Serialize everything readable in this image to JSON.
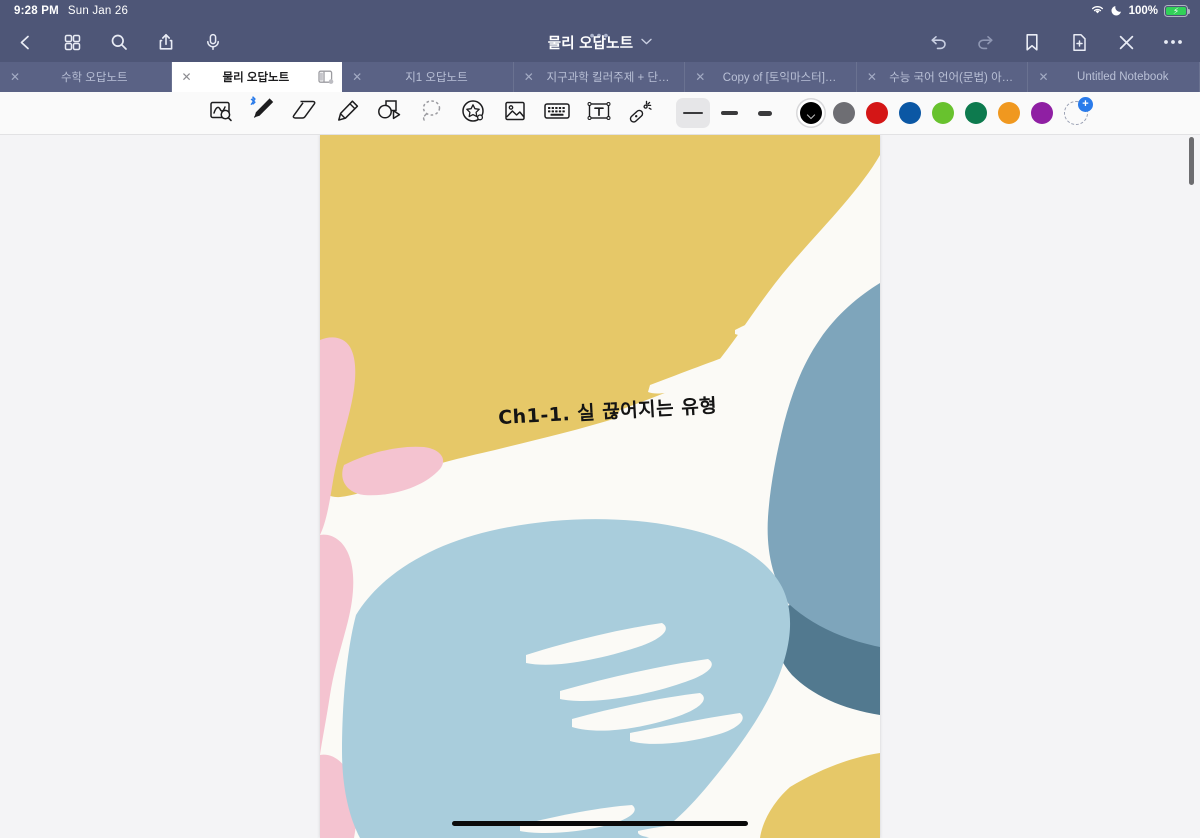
{
  "statusbar": {
    "time": "9:28 PM",
    "date": "Sun Jan 26",
    "battery_percent": "100%",
    "icons": [
      "wifi-icon",
      "moon-icon",
      "battery-charging-icon"
    ]
  },
  "titlebar": {
    "title": "물리 오답노트",
    "chevron": "⌄",
    "left_buttons": [
      {
        "name": "back-button",
        "icon": "chevron-left-icon"
      },
      {
        "name": "thumbnail-grid-button",
        "icon": "grid-icon"
      },
      {
        "name": "search-button",
        "icon": "search-icon"
      },
      {
        "name": "share-button",
        "icon": "share-icon"
      },
      {
        "name": "microphone-button",
        "icon": "microphone-icon"
      }
    ],
    "right_buttons": [
      {
        "name": "undo-button",
        "icon": "undo-icon"
      },
      {
        "name": "redo-button",
        "icon": "redo-icon"
      },
      {
        "name": "bookmark-button",
        "icon": "bookmark-icon"
      },
      {
        "name": "add-page-button",
        "icon": "document-plus-icon"
      },
      {
        "name": "close-button",
        "icon": "close-x-icon"
      },
      {
        "name": "more-button",
        "icon": "ellipsis-icon"
      }
    ]
  },
  "tabs": [
    {
      "label": "수학 오답노트",
      "active": false,
      "close": "✕"
    },
    {
      "label": "물리 오답노트",
      "active": true,
      "close": "✕"
    },
    {
      "label": "지1 오답노트",
      "active": false,
      "close": "✕"
    },
    {
      "label": "지구과학 킬러주제 + 단…",
      "active": false,
      "close": "✕"
    },
    {
      "label": "Copy of [토익마스터]…",
      "active": false,
      "close": "✕"
    },
    {
      "label": "수능 국어 언어(문법) 아…",
      "active": false,
      "close": "✕"
    },
    {
      "label": "Untitled Notebook",
      "active": false,
      "close": "✕"
    }
  ],
  "toolbar": {
    "tools": [
      {
        "name": "zoom-write-tool",
        "icon": "zoom-write-icon",
        "selected": false
      },
      {
        "name": "pen-tool",
        "icon": "pen-icon",
        "selected": true,
        "bluetooth": true
      },
      {
        "name": "eraser-tool",
        "icon": "eraser-icon",
        "selected": false
      },
      {
        "name": "highlighter-tool",
        "icon": "highlighter-icon",
        "selected": false
      },
      {
        "name": "shapes-tool",
        "icon": "shapes-icon",
        "selected": false
      },
      {
        "name": "lasso-tool",
        "icon": "lasso-icon",
        "selected": false
      },
      {
        "name": "sticker-tool",
        "icon": "sticker-star-icon",
        "selected": false
      },
      {
        "name": "image-tool",
        "icon": "image-icon",
        "selected": false
      },
      {
        "name": "keyboard-tool",
        "icon": "keyboard-icon",
        "selected": false
      },
      {
        "name": "text-box-tool",
        "icon": "text-box-icon",
        "selected": false
      },
      {
        "name": "magic-wand-tool",
        "icon": "magic-wand-icon",
        "selected": false
      }
    ],
    "stroke_widths": [
      {
        "name": "stroke-width-thin",
        "thickness": 2,
        "selected": true
      },
      {
        "name": "stroke-width-medium",
        "thickness": 3,
        "selected": false
      },
      {
        "name": "stroke-width-thick",
        "thickness": 5,
        "selected": false
      }
    ],
    "colors": [
      {
        "name": "color-black",
        "hex": "#000000",
        "selected": true
      },
      {
        "name": "color-gray",
        "hex": "#6e6e73",
        "selected": false
      },
      {
        "name": "color-red",
        "hex": "#d41616",
        "selected": false
      },
      {
        "name": "color-blue",
        "hex": "#0b57a4",
        "selected": false
      },
      {
        "name": "color-light-green",
        "hex": "#68c22e",
        "selected": false
      },
      {
        "name": "color-dark-green",
        "hex": "#0d7a4e",
        "selected": false
      },
      {
        "name": "color-orange",
        "hex": "#f0981f",
        "selected": false
      },
      {
        "name": "color-purple",
        "hex": "#8f1fa3",
        "selected": false
      }
    ],
    "add_color": {
      "name": "add-color-button",
      "plus": "+"
    }
  },
  "page": {
    "handwriting": "Ch1-1. 실 끊어지는 유형",
    "background_colors": {
      "paper": "#fbfaf6",
      "yellow": "#e6c868",
      "blue_gray": "#7ea5bb",
      "light_blue": "#a9cddc",
      "pink": "#f4c3d0",
      "dark_teal": "#52798f"
    }
  }
}
